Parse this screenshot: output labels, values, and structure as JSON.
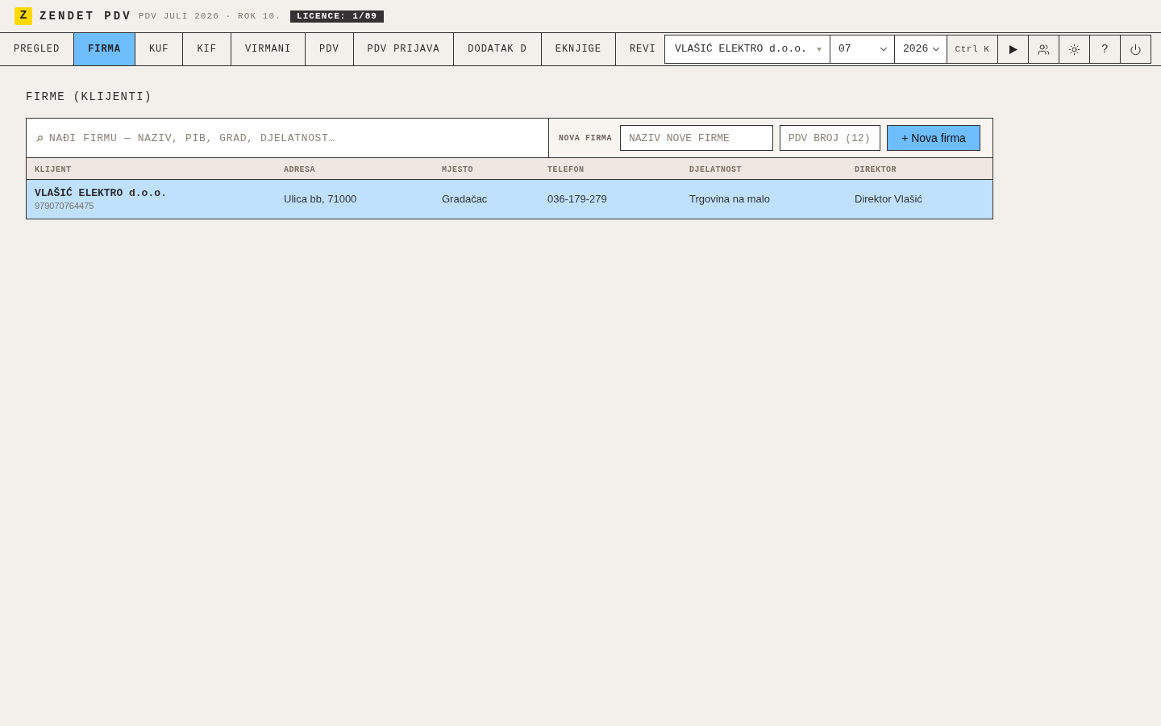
{
  "header": {
    "logo": "Z",
    "app_name": "ZENDET PDV",
    "period": "PDV JULI 2026 · ROK 10.",
    "licence": "LICENCE: 1/89"
  },
  "tabs": [
    {
      "label": "PREGLED",
      "selected": false
    },
    {
      "label": "FIRMA",
      "selected": true
    },
    {
      "label": "KUF",
      "selected": false
    },
    {
      "label": "KIF",
      "selected": false
    },
    {
      "label": "VIRMANI",
      "selected": false
    },
    {
      "label": "PDV",
      "selected": false
    },
    {
      "label": "PDV PRIJAVA",
      "selected": false
    },
    {
      "label": "DODATAK D",
      "selected": false
    },
    {
      "label": "EKNJIGE",
      "selected": false
    },
    {
      "label": "REVI",
      "selected": false
    }
  ],
  "toolbar": {
    "company": "VLAŠIĆ ELEKTRO d.o.o.",
    "month": "07",
    "year": "2026",
    "shortcut": "Ctrl K",
    "help": "?"
  },
  "page": {
    "title": "FIRME (KLIJENTI)",
    "search": {
      "placeholder": "NAĐI FIRMU — NAZIV, PIB, GRAD, DJELATNOST…"
    },
    "new_firm": {
      "label": "NOVA FIRMA",
      "name_field": {
        "placeholder": "NAZIV NOVE FIRME"
      },
      "vat_field": {
        "placeholder": "PDV BROJ (12)"
      },
      "button": "+ Nova firma"
    },
    "table": {
      "columns": [
        "KLIJENT",
        "ADRESA",
        "MJESTO",
        "TELEFON",
        "DJELATNOST",
        "DIREKTOR"
      ],
      "rows": [
        {
          "selected": true,
          "cells": [
            {
              "kind": "client",
              "text": "VLAŠIĆ ELEKTRO d.o.o.",
              "subtext": "979070764475"
            },
            {
              "kind": "text",
              "text": "Ulica bb, 71000"
            },
            {
              "kind": "text",
              "text": "Gradačac"
            },
            {
              "kind": "text",
              "text": "036-179-279"
            },
            {
              "kind": "text",
              "text": "Trgovina na malo"
            },
            {
              "kind": "text",
              "text": "Direktor Vlašić"
            }
          ]
        }
      ]
    }
  }
}
